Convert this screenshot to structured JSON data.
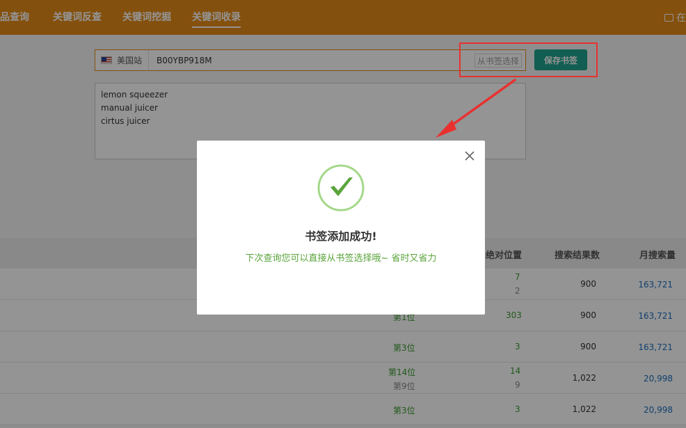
{
  "nav": {
    "items": [
      {
        "label": "产品查询",
        "active": false
      },
      {
        "label": "关键词反查",
        "active": false
      },
      {
        "label": "关键词挖掘",
        "active": false
      },
      {
        "label": "关键词收录",
        "active": true
      }
    ],
    "right_label": "在"
  },
  "search": {
    "site_label": "美国站",
    "asin_value": "B00YBP918M",
    "bookmark_select_label": "从书签选择",
    "save_button_label": "保存书签"
  },
  "keywords": [
    "lemon squeezer",
    "manual juicer",
    "cirtus juicer"
  ],
  "table": {
    "headers": [
      "绝对位置",
      "搜索结果数",
      "月搜索量"
    ],
    "rows": [
      {
        "rank": "",
        "rank2": "",
        "abs": "7",
        "abs2": "2",
        "results": "900",
        "monthly": "163,721"
      },
      {
        "rank": "第1位",
        "rank2": "",
        "abs": "303",
        "abs2": "",
        "results": "900",
        "monthly": "163,721"
      },
      {
        "rank": "第3位",
        "rank2": "",
        "abs": "3",
        "abs2": "",
        "results": "900",
        "monthly": "163,721"
      },
      {
        "rank": "第14位",
        "rank2": "第9位",
        "abs": "14",
        "abs2": "9",
        "results": "1,022",
        "monthly": "20,998"
      },
      {
        "rank": "第3位",
        "rank2": "",
        "abs": "3",
        "abs2": "",
        "results": "1,022",
        "monthly": "20,998"
      }
    ]
  },
  "modal": {
    "title": "书签添加成功!",
    "message": "下次查询您可以直接从书签选择哦~ 省时又省力"
  },
  "colors": {
    "header": "#e48b17",
    "accent_green": "#1fa38d",
    "annotation_red": "#e8312f",
    "success_green": "#5aa43b"
  }
}
